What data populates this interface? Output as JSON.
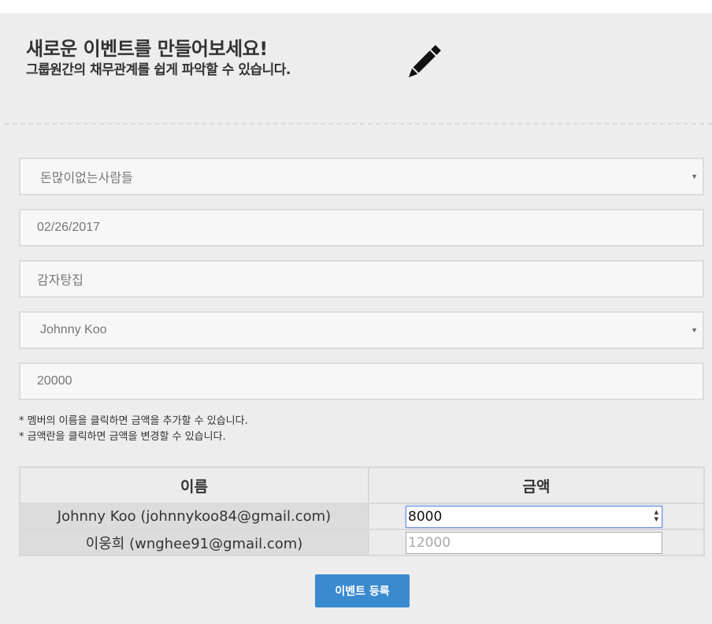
{
  "header": {
    "title": "새로운 이벤트를 만들어보세요!",
    "subtitle": "그룹원간의 채무관계를 쉽게 파악할 수 있습니다.",
    "icon": "pencil-icon"
  },
  "form": {
    "group_select": "돈많이없는사람들",
    "date": "02/26/2017",
    "place": "감자탕집",
    "payer_select": "Johnny Koo",
    "total": "20000"
  },
  "notes": [
    "* 멤버의 이름을 클릭하면 금액을 추가할 수 있습니다.",
    "* 금액란을 클릭하면 금액을 변경할 수 있습니다."
  ],
  "table": {
    "headers": [
      "이름",
      "금액"
    ],
    "rows": [
      {
        "name": "Johnny Koo (johnnykoo84@gmail.com)",
        "amount": "8000",
        "placeholder": false
      },
      {
        "name": "이웅희 (wnghee91@gmail.com)",
        "amount": "12000",
        "placeholder": true
      }
    ]
  },
  "submit_label": "이벤트 등록",
  "colors": {
    "panel": "#ededed",
    "accent": "#3a8ad0"
  }
}
